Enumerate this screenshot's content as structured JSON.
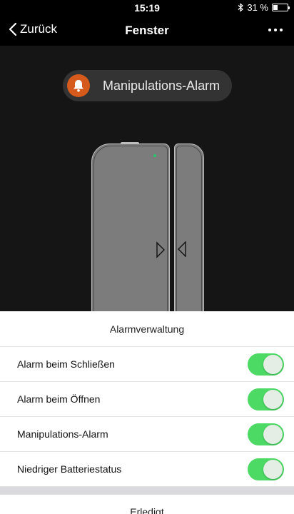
{
  "status_bar": {
    "time": "15:19",
    "battery_text": "31 %",
    "battery_level": 0.31,
    "icons": [
      "bluetooth-icon",
      "battery-icon"
    ]
  },
  "nav": {
    "back_label": "Zurück",
    "title": "Fenster",
    "more_icon": "more-dots-icon"
  },
  "stage": {
    "alarm_pill_label": "Manipulations-Alarm",
    "alarm_pill_icon": "bell-icon",
    "alarm_pill_icon_color": "#d65a1c",
    "led_color": "#29c46b"
  },
  "sheet": {
    "title": "Alarmverwaltung",
    "rows": [
      {
        "label": "Alarm beim Schließen",
        "enabled": true
      },
      {
        "label": "Alarm beim Öffnen",
        "enabled": true
      },
      {
        "label": "Manipulations-Alarm",
        "enabled": true
      },
      {
        "label": "Niedriger Batteriestatus",
        "enabled": true
      }
    ],
    "toggle_on_color": "#4cd964",
    "done_label": "Erledigt"
  }
}
